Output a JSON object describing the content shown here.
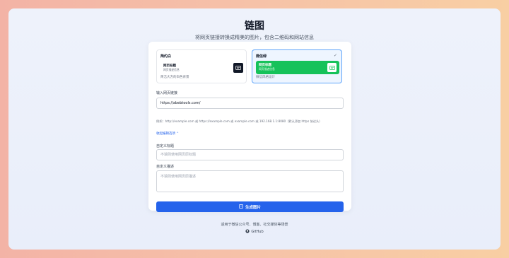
{
  "header": {
    "title": "链图",
    "subtitle": "将网页链接转换成精美的图片，包含二维码和网站信息"
  },
  "styles": [
    {
      "name": "简约白",
      "preview_title": "网页标题",
      "preview_desc": "网页描述信息",
      "description": "简洁大方的白色背景",
      "selected": false
    },
    {
      "name": "微信绿",
      "preview_title": "网页标题",
      "preview_desc": "网页描述信息",
      "description": "微信风格设计",
      "selected": true,
      "check": "✓"
    }
  ],
  "form": {
    "url_label": "输入网页链接",
    "url_value": "https://abebtools.com/",
    "url_hint": "例如：http://example.com 或 https://example.com 或 example.com 或 192.168.1.1:8080（默认添加 https 协议头）",
    "toggle_label": "收起编辑选项 ⌃",
    "custom_title_label": "自定义标题",
    "custom_title_placeholder": "不填则使用网页原标题",
    "custom_desc_label": "自定义描述",
    "custom_desc_placeholder": "不填则使用网页原描述",
    "generate_label": "生成图片"
  },
  "footer": {
    "text": "适用于微信公众号、博客、社交媒体等场景",
    "github_label": "GitHub"
  },
  "colors": {
    "accent": "#2563eb",
    "wechat_green": "#16c25a"
  }
}
